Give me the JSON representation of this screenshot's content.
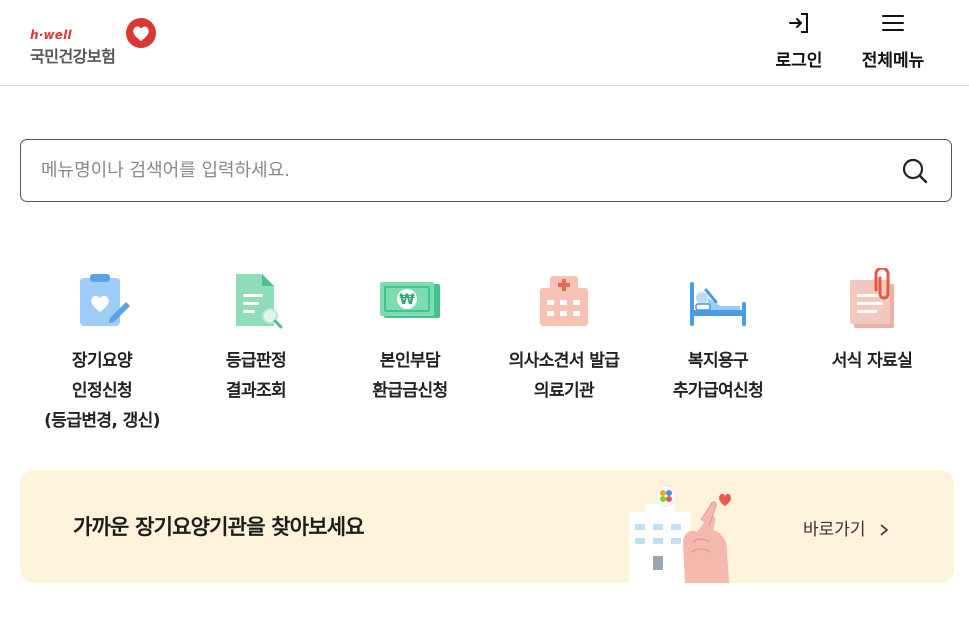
{
  "header": {
    "logo_sub": "h·well",
    "logo_name": "국민건강보험",
    "login_label": "로그인",
    "menu_label": "전체메뉴"
  },
  "search": {
    "placeholder": "메뉴명이나 검색어를 입력하세요."
  },
  "quick_menu": [
    {
      "icon": "clipboard-heart-icon",
      "lines": [
        "장기요양",
        "인정신청",
        "(등급변경, 갱신)"
      ]
    },
    {
      "icon": "document-search-icon",
      "lines": [
        "등급판정",
        "결과조회"
      ]
    },
    {
      "icon": "won-banknote-icon",
      "lines": [
        "본인부담",
        "환급금신청"
      ]
    },
    {
      "icon": "hospital-icon",
      "lines": [
        "의사소견서 발급",
        "의료기관"
      ]
    },
    {
      "icon": "care-bed-icon",
      "lines": [
        "복지용구",
        "추가급여신청"
      ]
    },
    {
      "icon": "paperclip-document-icon",
      "lines": [
        "서식 자료실"
      ]
    }
  ],
  "banner": {
    "title": "가까운 장기요양기관을 찾아보세요",
    "link_label": "바로가기"
  },
  "colors": {
    "brand_red": "#d8382f",
    "banner_bg": "#fff3dc",
    "icon_blue": "#7bb8f0",
    "icon_green": "#7dd3ab",
    "icon_pink": "#f6c4b6"
  }
}
